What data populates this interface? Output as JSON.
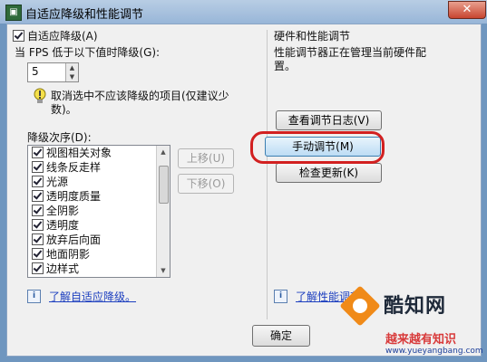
{
  "window": {
    "title": "自适应降级和性能调节",
    "close_label": "✕"
  },
  "left": {
    "adaptive_checkbox_label": "自适应降级(A)",
    "fps_label": "当 FPS 低于以下值时降级(G):",
    "fps_value": "5",
    "tip_text_line1": "取消选中不应该降级的项目(仅建议少",
    "tip_text_line2": "数)。",
    "order_label": "降级次序(D):",
    "items": [
      "视图相关对象",
      "线条反走样",
      "光源",
      "透明度质量",
      "全阴影",
      "透明度",
      "放弃后向面",
      "地面阴影",
      "边样式"
    ],
    "move_up_label": "上移(U)",
    "move_down_label": "下移(O)",
    "learn_link": "了解自适应降级。"
  },
  "right": {
    "section_title": "硬件和性能调节",
    "status_line1": "性能调节器正在管理当前硬件配",
    "status_line2": "置。",
    "view_log_label": "查看调节日志(V)",
    "manual_tune_label": "手动调节(M)",
    "check_update_label": "检查更新(K)",
    "learn_link": "了解性能调节"
  },
  "footer": {
    "ok_label": "确定"
  },
  "watermark": {
    "title": "酷知网",
    "subtitle": "越来越有知识",
    "url": "www.yueyangbang.com"
  },
  "colors": {
    "highlight_ring": "#d22020",
    "link": "#1d3fbf",
    "title_bar": "#98b6d8"
  }
}
